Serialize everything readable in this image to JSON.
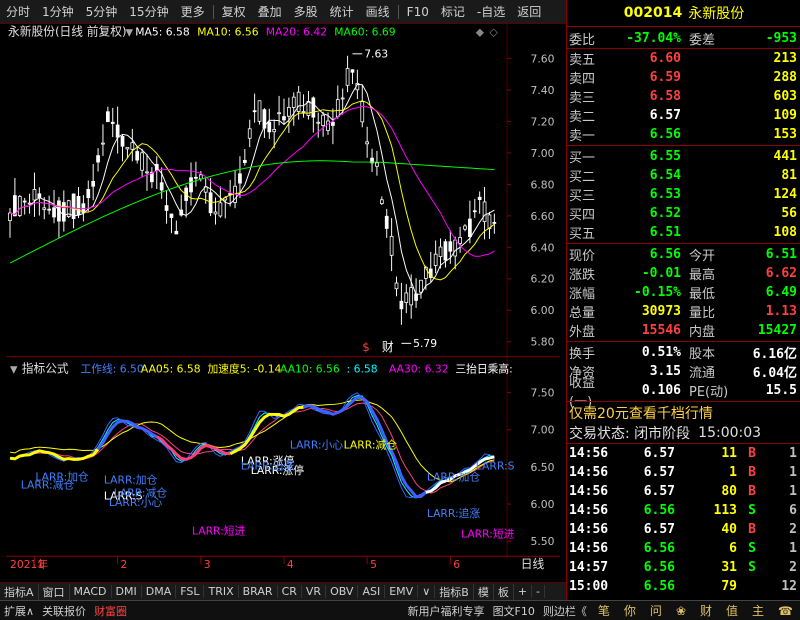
{
  "toolbar": {
    "items": [
      "分时",
      "1分钟",
      "5分钟",
      "15分钟",
      "更多",
      "复权",
      "叠加",
      "多股",
      "统计",
      "画线",
      "F10",
      "标记",
      "-自选",
      "返回"
    ]
  },
  "main_chart": {
    "title": "永新股份(日线 前复权)",
    "ma_labels": [
      {
        "text": "MA5: 6.58",
        "color": "#ffffff"
      },
      {
        "text": "MA10: 6.56",
        "color": "#ffff00"
      },
      {
        "text": "MA20: 6.42",
        "color": "#ff00ff"
      },
      {
        "text": "MA60: 6.69",
        "color": "#00ff00"
      }
    ],
    "high_label": "7.63",
    "low_label": "5.79",
    "marker_s": "$",
    "marker_cai": "财",
    "y_ticks": [
      "7.60",
      "7.40",
      "7.20",
      "7.00",
      "6.80",
      "6.60",
      "6.40",
      "6.20",
      "6.00",
      "5.80"
    ]
  },
  "indicator": {
    "title": "指标公式",
    "labels": [
      {
        "text": "工作线: 6.50",
        "color": "#4080ff"
      },
      {
        "text": "AA05: 6.58",
        "color": "#ffff00"
      },
      {
        "text": "加速度5: -0.14",
        "color": "#ffff00"
      },
      {
        "text": "AA10: 6.56",
        "color": "#00ff00"
      },
      {
        "text": ": 6.58",
        "color": "#00ffff"
      },
      {
        "text": "AA30: 6.32",
        "color": "#ff00ff"
      },
      {
        "text": "三抬日乘高:",
        "color": "#ffffff"
      }
    ],
    "y_ticks": [
      "7.50",
      "7.00",
      "6.50",
      "6.00",
      "5.50"
    ],
    "annotations": [
      {
        "text": "LARR:小心",
        "color": "#4080ff"
      },
      {
        "text": "LARR:S",
        "color": "#ffffff"
      },
      {
        "text": "LARR:减仓",
        "color": "#4080ff"
      },
      {
        "text": "LARR:减仓",
        "color": "#4080ff"
      },
      {
        "text": "LARR:加仓",
        "color": "#4080ff"
      },
      {
        "text": "LARR:加仓",
        "color": "#4080ff"
      },
      {
        "text": "LARR:短进",
        "color": "#ff00ff"
      },
      {
        "text": "LARR:涨停",
        "color": "#ffffff"
      },
      {
        "text": "LARR:涨停",
        "color": "#ffffff"
      },
      {
        "text": "LARR:追涨",
        "color": "#4080ff"
      },
      {
        "text": "LARR:短进",
        "color": "#ff00ff"
      },
      {
        "text": "LARR:S",
        "color": "#4080ff"
      },
      {
        "text": "LARR:小心",
        "color": "#4080ff"
      },
      {
        "text": "LARR:减仓",
        "color": "#ffff00"
      },
      {
        "text": "LARR:追涨",
        "color": "#4080ff"
      },
      {
        "text": "LARR:加仓",
        "color": "#4080ff"
      }
    ]
  },
  "x_axis": {
    "year": "2021年",
    "months": [
      "1",
      "2",
      "3",
      "4",
      "5",
      "6"
    ],
    "period": "日线"
  },
  "bottom_tabs": [
    "指标A",
    "窗口",
    "MACD",
    "DMI",
    "DMA",
    "FSL",
    "TRIX",
    "BRAR",
    "CR",
    "VR",
    "OBV",
    "ASI",
    "EMV",
    "∨",
    "指标B",
    "模",
    "板",
    "+",
    "-"
  ],
  "status_bar": {
    "left": [
      "扩展∧",
      "关联报价",
      "财富圈"
    ],
    "right": [
      "新用户福利专享",
      "图文F10",
      "则边栏《"
    ],
    "icons": [
      "笔",
      "你",
      "问",
      "❀",
      "财",
      "值",
      "主",
      "☎"
    ]
  },
  "quote_panel": {
    "code": "002014",
    "name": "永新股份",
    "weibi": {
      "label": "委比",
      "value": "-37.04%",
      "label2": "委差",
      "value2": "-953"
    },
    "sell": [
      {
        "label": "卖五",
        "price": "6.60",
        "vol": "213",
        "color": "red"
      },
      {
        "label": "卖四",
        "price": "6.59",
        "vol": "288",
        "color": "red"
      },
      {
        "label": "卖三",
        "price": "6.58",
        "vol": "603",
        "color": "red"
      },
      {
        "label": "卖二",
        "price": "6.57",
        "vol": "109",
        "color": "white"
      },
      {
        "label": "卖一",
        "price": "6.56",
        "vol": "153",
        "color": "green"
      }
    ],
    "buy": [
      {
        "label": "买一",
        "price": "6.55",
        "vol": "441",
        "color": "green"
      },
      {
        "label": "买二",
        "price": "6.54",
        "vol": "81",
        "color": "green"
      },
      {
        "label": "买三",
        "price": "6.53",
        "vol": "124",
        "color": "green"
      },
      {
        "label": "买四",
        "price": "6.52",
        "vol": "56",
        "color": "green"
      },
      {
        "label": "买五",
        "price": "6.51",
        "vol": "108",
        "color": "green"
      }
    ],
    "stats": [
      {
        "l1": "现价",
        "v1": "6.56",
        "c1": "green",
        "l2": "今开",
        "v2": "6.51",
        "c2": "green"
      },
      {
        "l1": "涨跌",
        "v1": "-0.01",
        "c1": "green",
        "l2": "最高",
        "v2": "6.62",
        "c2": "red"
      },
      {
        "l1": "涨幅",
        "v1": "-0.15%",
        "c1": "green",
        "l2": "最低",
        "v2": "6.49",
        "c2": "green"
      },
      {
        "l1": "总量",
        "v1": "30973",
        "c1": "yellow",
        "l2": "量比",
        "v2": "1.13",
        "c2": "red"
      },
      {
        "l1": "外盘",
        "v1": "15546",
        "c1": "red",
        "l2": "内盘",
        "v2": "15427",
        "c2": "green"
      }
    ],
    "stats2": [
      {
        "l1": "换手",
        "v1": "0.51%",
        "l2": "股本",
        "v2": "6.16亿"
      },
      {
        "l1": "净资",
        "v1": "3.15",
        "l2": "流通",
        "v2": "6.04亿"
      },
      {
        "l1": "收益(一)",
        "v1": "0.106",
        "l2": "PE(动)",
        "v2": "15.5"
      }
    ],
    "promo": "仅需20元查看千档行情",
    "trade_status": "交易状态: 闭市阶段",
    "trade_time": "15:00:03",
    "ticks": [
      {
        "time": "14:56",
        "price": "6.57",
        "pc": "white",
        "vol": "11",
        "bs": "B",
        "n": "1"
      },
      {
        "time": "14:56",
        "price": "6.57",
        "pc": "white",
        "vol": "1",
        "bs": "B",
        "n": "1"
      },
      {
        "time": "14:56",
        "price": "6.57",
        "pc": "white",
        "vol": "80",
        "bs": "B",
        "n": "1"
      },
      {
        "time": "14:56",
        "price": "6.56",
        "pc": "green",
        "vol": "113",
        "bs": "S",
        "n": "6"
      },
      {
        "time": "14:56",
        "price": "6.57",
        "pc": "white",
        "vol": "40",
        "bs": "B",
        "n": "2"
      },
      {
        "time": "14:56",
        "price": "6.56",
        "pc": "green",
        "vol": "6",
        "bs": "S",
        "n": "1"
      },
      {
        "time": "14:57",
        "price": "6.56",
        "pc": "green",
        "vol": "31",
        "bs": "S",
        "n": "2"
      },
      {
        "time": "15:00",
        "price": "6.56",
        "pc": "green",
        "vol": "79",
        "bs": "",
        "n": "12"
      }
    ]
  }
}
